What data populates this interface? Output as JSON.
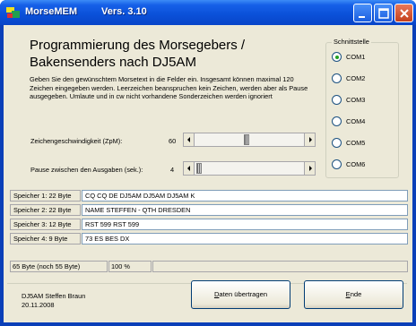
{
  "window": {
    "title": "MorseMEM",
    "version": "Vers. 3.10"
  },
  "heading": {
    "line1": "Programmierung des Morsegebers /",
    "line2": "Bakensenders nach DJ5AM"
  },
  "description": "Geben Sie den gewünschtem Morsetext in die Felder ein. Insgesamt können maximal 120 Zeichen eingegeben werden. Leerzeichen beanspruchen kein Zeichen, werden aber als Pause ausgegeben. Umlaute und in cw nicht vorhandene Sonderzeichen werden ignoriert",
  "speed": {
    "label": "Zeichengeschwindigkeit (ZpM):",
    "value": "60",
    "position_fraction": 0.47
  },
  "pause": {
    "label": "Pause zwischen den Ausgaben (sek.):",
    "value": "4",
    "position_fraction": 0.0
  },
  "interface": {
    "title": "Schnittstelle",
    "options": [
      "COM1",
      "COM2",
      "COM3",
      "COM4",
      "COM5",
      "COM6"
    ],
    "selected": "COM1"
  },
  "memory": [
    {
      "label": "Speicher 1: 22 Byte",
      "text": "CQ CQ DE DJ5AM DJ5AM DJ5AM K"
    },
    {
      "label": "Speicher 2: 22 Byte",
      "text": "NAME STEFFEN - QTH DRESDEN"
    },
    {
      "label": "Speicher 3: 12 Byte",
      "text": "RST 599 RST 599"
    },
    {
      "label": "Speicher 4: 9 Byte",
      "text": "73 ES BES DX"
    }
  ],
  "summary": {
    "bytes": "65 Byte (noch 55 Byte)",
    "percent": "100 %",
    "progress_fraction": 0.0
  },
  "footer": {
    "author": "DJ5AM Steffen Braun",
    "date": "20.11.2008",
    "transfer_button": "Daten übertragen",
    "end_button": "Ende"
  },
  "colors": {
    "title_bar": "#0a50d8",
    "window_bg": "#ece9d8",
    "radio_dot": "#21a121"
  }
}
